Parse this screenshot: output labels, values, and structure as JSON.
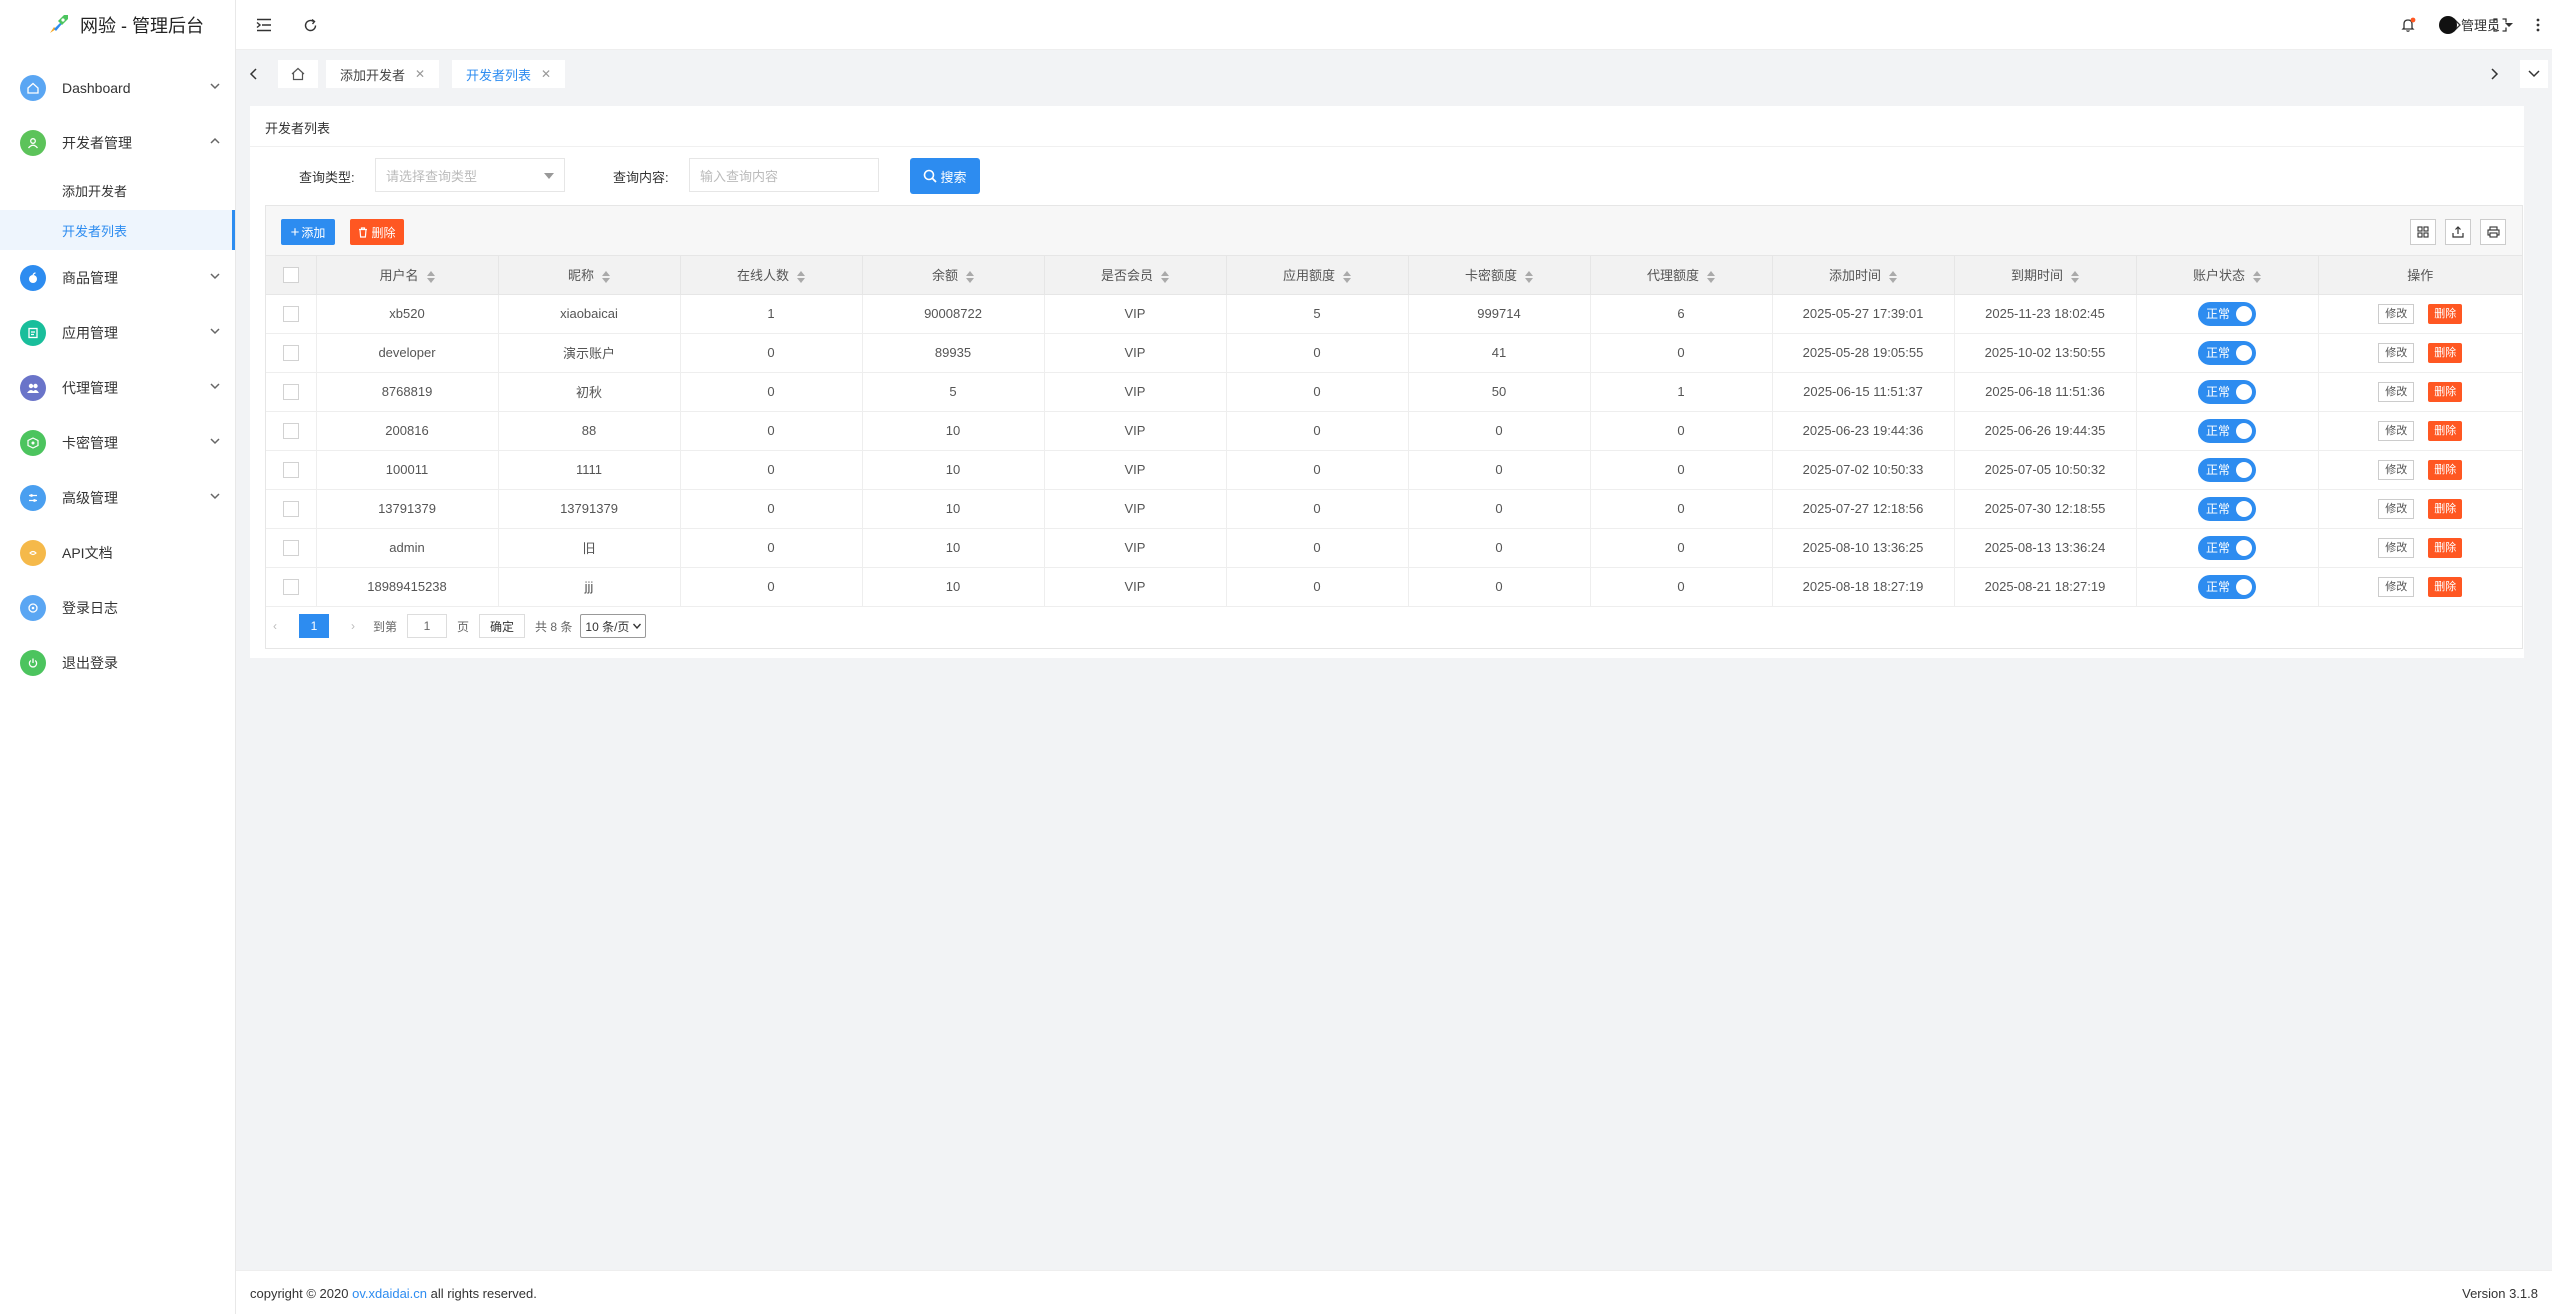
{
  "app": {
    "title": "网验 - 管理后台"
  },
  "colors": {
    "primary": "#2d8cf0",
    "danger": "#ff5722"
  },
  "sidebar": {
    "items": [
      {
        "label": "Dashboard",
        "icon": "home-icon",
        "color": "#5aa6f3"
      },
      {
        "label": "开发者管理",
        "icon": "user-icon",
        "color": "#5cc35a"
      },
      {
        "label": "商品管理",
        "icon": "apple-icon",
        "color": "#2d8cf0"
      },
      {
        "label": "应用管理",
        "icon": "app-icon",
        "color": "#19be9b"
      },
      {
        "label": "代理管理",
        "icon": "group-icon",
        "color": "#6a74c9"
      },
      {
        "label": "卡密管理",
        "icon": "card-icon",
        "color": "#4cc45e"
      },
      {
        "label": "高级管理",
        "icon": "settings-icon",
        "color": "#4a9ff0"
      },
      {
        "label": "API文档",
        "icon": "doc-icon",
        "color": "#f5b94a"
      },
      {
        "label": "登录日志",
        "icon": "log-icon",
        "color": "#5aa6f3"
      },
      {
        "label": "退出登录",
        "icon": "power-icon",
        "color": "#4cc45e"
      }
    ],
    "sub_items": [
      {
        "label": "添加开发者"
      },
      {
        "label": "开发者列表"
      }
    ]
  },
  "header": {
    "admin_label": "管理员"
  },
  "tabs": [
    {
      "label": "添加开发者"
    },
    {
      "label": "开发者列表"
    }
  ],
  "main": {
    "card_title": "开发者列表",
    "query_type_label": "查询类型:",
    "query_type_placeholder": "请选择查询类型",
    "query_content_label": "查询内容:",
    "query_content_placeholder": "输入查询内容",
    "search_label": "搜索",
    "add_label": "添加",
    "delete_label": "删除"
  },
  "table": {
    "columns": [
      "用户名",
      "昵称",
      "在线人数",
      "余额",
      "是否会员",
      "应用额度",
      "卡密额度",
      "代理额度",
      "添加时间",
      "到期时间",
      "账户状态",
      "操作"
    ],
    "rows": [
      [
        "xb520",
        "xiaobaicai",
        "1",
        "90008722",
        "VIP",
        "5",
        "999714",
        "6",
        "2025-05-27 17:39:01",
        "2025-11-23 18:02:45"
      ],
      [
        "developer",
        "演示账户",
        "0",
        "89935",
        "VIP",
        "0",
        "41",
        "0",
        "2025-05-28 19:05:55",
        "2025-10-02 13:50:55"
      ],
      [
        "8768819",
        "初秋",
        "0",
        "5",
        "VIP",
        "0",
        "50",
        "1",
        "2025-06-15 11:51:37",
        "2025-06-18 11:51:36"
      ],
      [
        "200816",
        "88",
        "0",
        "10",
        "VIP",
        "0",
        "0",
        "0",
        "2025-06-23 19:44:36",
        "2025-06-26 19:44:35"
      ],
      [
        "100011",
        "1111",
        "0",
        "10",
        "VIP",
        "0",
        "0",
        "0",
        "2025-07-02 10:50:33",
        "2025-07-05 10:50:32"
      ],
      [
        "13791379",
        "13791379",
        "0",
        "10",
        "VIP",
        "0",
        "0",
        "0",
        "2025-07-27 12:18:56",
        "2025-07-30 12:18:55"
      ],
      [
        "admin",
        "旧",
        "0",
        "10",
        "VIP",
        "0",
        "0",
        "0",
        "2025-08-10 13:36:25",
        "2025-08-13 13:36:24"
      ],
      [
        "18989415238",
        "jjj",
        "0",
        "10",
        "VIP",
        "0",
        "0",
        "0",
        "2025-08-18 18:27:19",
        "2025-08-21 18:27:19"
      ]
    ],
    "status_label": "正常",
    "edit_label": "修改",
    "row_delete_label": "删除"
  },
  "pager": {
    "current_page": "1",
    "goto_label": "到第",
    "goto_value": "1",
    "page_unit": "页",
    "confirm_label": "确定",
    "total_label": "共 8 条",
    "page_size": "10 条/页"
  },
  "footer": {
    "copyright_prefix": "copyright © 2020",
    "domain": "ov.xdaidai.cn",
    "copyright_suffix": "all rights reserved.",
    "version": "Version 3.1.8"
  }
}
